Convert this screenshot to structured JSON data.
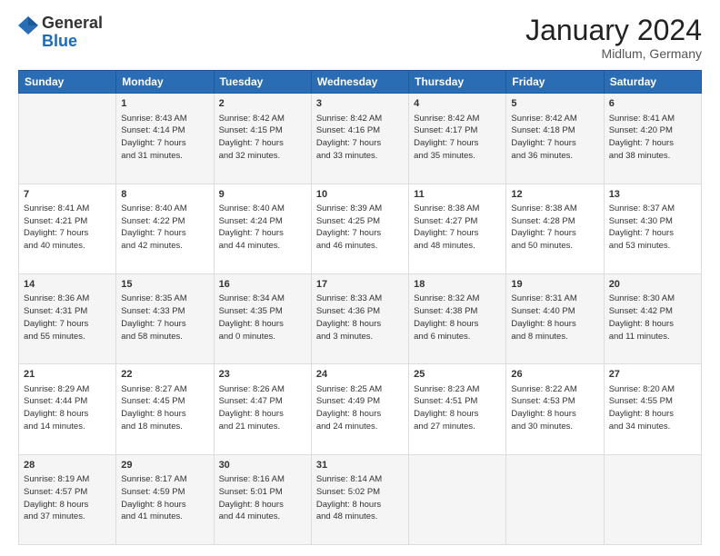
{
  "logo": {
    "general": "General",
    "blue": "Blue"
  },
  "title": "January 2024",
  "subtitle": "Midlum, Germany",
  "days_header": [
    "Sunday",
    "Monday",
    "Tuesday",
    "Wednesday",
    "Thursday",
    "Friday",
    "Saturday"
  ],
  "weeks": [
    [
      {
        "day": "",
        "info": ""
      },
      {
        "day": "1",
        "info": "Sunrise: 8:43 AM\nSunset: 4:14 PM\nDaylight: 7 hours\nand 31 minutes."
      },
      {
        "day": "2",
        "info": "Sunrise: 8:42 AM\nSunset: 4:15 PM\nDaylight: 7 hours\nand 32 minutes."
      },
      {
        "day": "3",
        "info": "Sunrise: 8:42 AM\nSunset: 4:16 PM\nDaylight: 7 hours\nand 33 minutes."
      },
      {
        "day": "4",
        "info": "Sunrise: 8:42 AM\nSunset: 4:17 PM\nDaylight: 7 hours\nand 35 minutes."
      },
      {
        "day": "5",
        "info": "Sunrise: 8:42 AM\nSunset: 4:18 PM\nDaylight: 7 hours\nand 36 minutes."
      },
      {
        "day": "6",
        "info": "Sunrise: 8:41 AM\nSunset: 4:20 PM\nDaylight: 7 hours\nand 38 minutes."
      }
    ],
    [
      {
        "day": "7",
        "info": "Sunrise: 8:41 AM\nSunset: 4:21 PM\nDaylight: 7 hours\nand 40 minutes."
      },
      {
        "day": "8",
        "info": "Sunrise: 8:40 AM\nSunset: 4:22 PM\nDaylight: 7 hours\nand 42 minutes."
      },
      {
        "day": "9",
        "info": "Sunrise: 8:40 AM\nSunset: 4:24 PM\nDaylight: 7 hours\nand 44 minutes."
      },
      {
        "day": "10",
        "info": "Sunrise: 8:39 AM\nSunset: 4:25 PM\nDaylight: 7 hours\nand 46 minutes."
      },
      {
        "day": "11",
        "info": "Sunrise: 8:38 AM\nSunset: 4:27 PM\nDaylight: 7 hours\nand 48 minutes."
      },
      {
        "day": "12",
        "info": "Sunrise: 8:38 AM\nSunset: 4:28 PM\nDaylight: 7 hours\nand 50 minutes."
      },
      {
        "day": "13",
        "info": "Sunrise: 8:37 AM\nSunset: 4:30 PM\nDaylight: 7 hours\nand 53 minutes."
      }
    ],
    [
      {
        "day": "14",
        "info": "Sunrise: 8:36 AM\nSunset: 4:31 PM\nDaylight: 7 hours\nand 55 minutes."
      },
      {
        "day": "15",
        "info": "Sunrise: 8:35 AM\nSunset: 4:33 PM\nDaylight: 7 hours\nand 58 minutes."
      },
      {
        "day": "16",
        "info": "Sunrise: 8:34 AM\nSunset: 4:35 PM\nDaylight: 8 hours\nand 0 minutes."
      },
      {
        "day": "17",
        "info": "Sunrise: 8:33 AM\nSunset: 4:36 PM\nDaylight: 8 hours\nand 3 minutes."
      },
      {
        "day": "18",
        "info": "Sunrise: 8:32 AM\nSunset: 4:38 PM\nDaylight: 8 hours\nand 6 minutes."
      },
      {
        "day": "19",
        "info": "Sunrise: 8:31 AM\nSunset: 4:40 PM\nDaylight: 8 hours\nand 8 minutes."
      },
      {
        "day": "20",
        "info": "Sunrise: 8:30 AM\nSunset: 4:42 PM\nDaylight: 8 hours\nand 11 minutes."
      }
    ],
    [
      {
        "day": "21",
        "info": "Sunrise: 8:29 AM\nSunset: 4:44 PM\nDaylight: 8 hours\nand 14 minutes."
      },
      {
        "day": "22",
        "info": "Sunrise: 8:27 AM\nSunset: 4:45 PM\nDaylight: 8 hours\nand 18 minutes."
      },
      {
        "day": "23",
        "info": "Sunrise: 8:26 AM\nSunset: 4:47 PM\nDaylight: 8 hours\nand 21 minutes."
      },
      {
        "day": "24",
        "info": "Sunrise: 8:25 AM\nSunset: 4:49 PM\nDaylight: 8 hours\nand 24 minutes."
      },
      {
        "day": "25",
        "info": "Sunrise: 8:23 AM\nSunset: 4:51 PM\nDaylight: 8 hours\nand 27 minutes."
      },
      {
        "day": "26",
        "info": "Sunrise: 8:22 AM\nSunset: 4:53 PM\nDaylight: 8 hours\nand 30 minutes."
      },
      {
        "day": "27",
        "info": "Sunrise: 8:20 AM\nSunset: 4:55 PM\nDaylight: 8 hours\nand 34 minutes."
      }
    ],
    [
      {
        "day": "28",
        "info": "Sunrise: 8:19 AM\nSunset: 4:57 PM\nDaylight: 8 hours\nand 37 minutes."
      },
      {
        "day": "29",
        "info": "Sunrise: 8:17 AM\nSunset: 4:59 PM\nDaylight: 8 hours\nand 41 minutes."
      },
      {
        "day": "30",
        "info": "Sunrise: 8:16 AM\nSunset: 5:01 PM\nDaylight: 8 hours\nand 44 minutes."
      },
      {
        "day": "31",
        "info": "Sunrise: 8:14 AM\nSunset: 5:02 PM\nDaylight: 8 hours\nand 48 minutes."
      },
      {
        "day": "",
        "info": ""
      },
      {
        "day": "",
        "info": ""
      },
      {
        "day": "",
        "info": ""
      }
    ]
  ]
}
